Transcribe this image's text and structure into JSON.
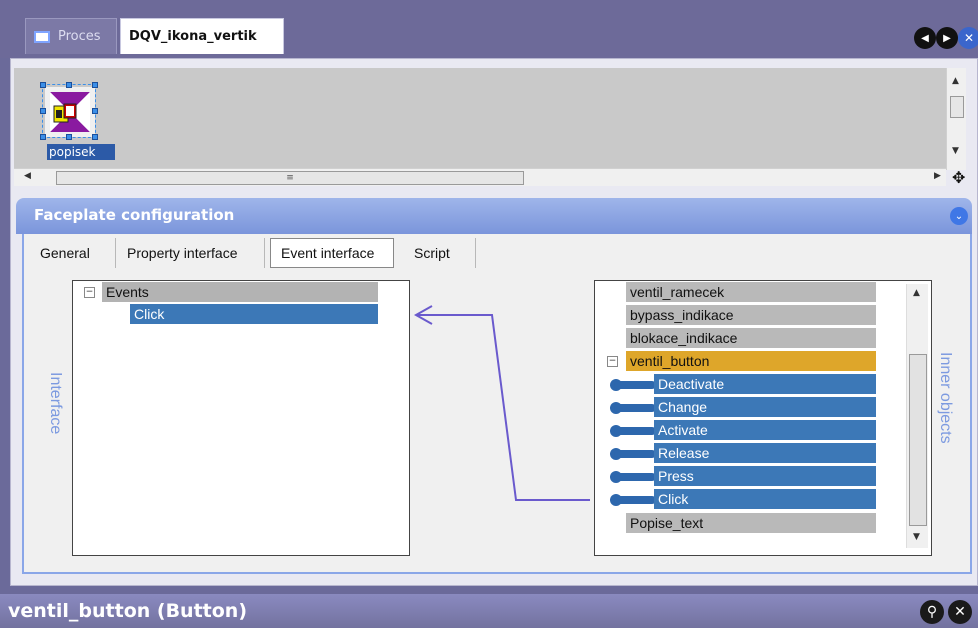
{
  "tabs": {
    "proces": "Proces",
    "active": "DQV_ikona_vertik"
  },
  "canvas": {
    "widget_label": "popisek"
  },
  "faceplate": {
    "title": "Faceplate configuration",
    "subtabs": [
      "General",
      "Property interface",
      "Event interface",
      "Script"
    ],
    "left_label": "Interface",
    "right_label": "Inner objects",
    "interface_tree": {
      "group": "Events",
      "items": [
        "Click"
      ]
    },
    "inner_objects": {
      "before": [
        "ventil_ramecek",
        "bypass_indikace",
        "blokace_indikace"
      ],
      "expanded": "ventil_button",
      "events": [
        "Deactivate",
        "Change",
        "Activate",
        "Release",
        "Press",
        "Click"
      ],
      "after": [
        "Popise_text"
      ]
    }
  },
  "bottom": {
    "title": "ventil_button (Button)"
  },
  "colors": {
    "accent": "#3c78b7",
    "highlight": "#dea62a",
    "arrow": "#6a5acd"
  }
}
